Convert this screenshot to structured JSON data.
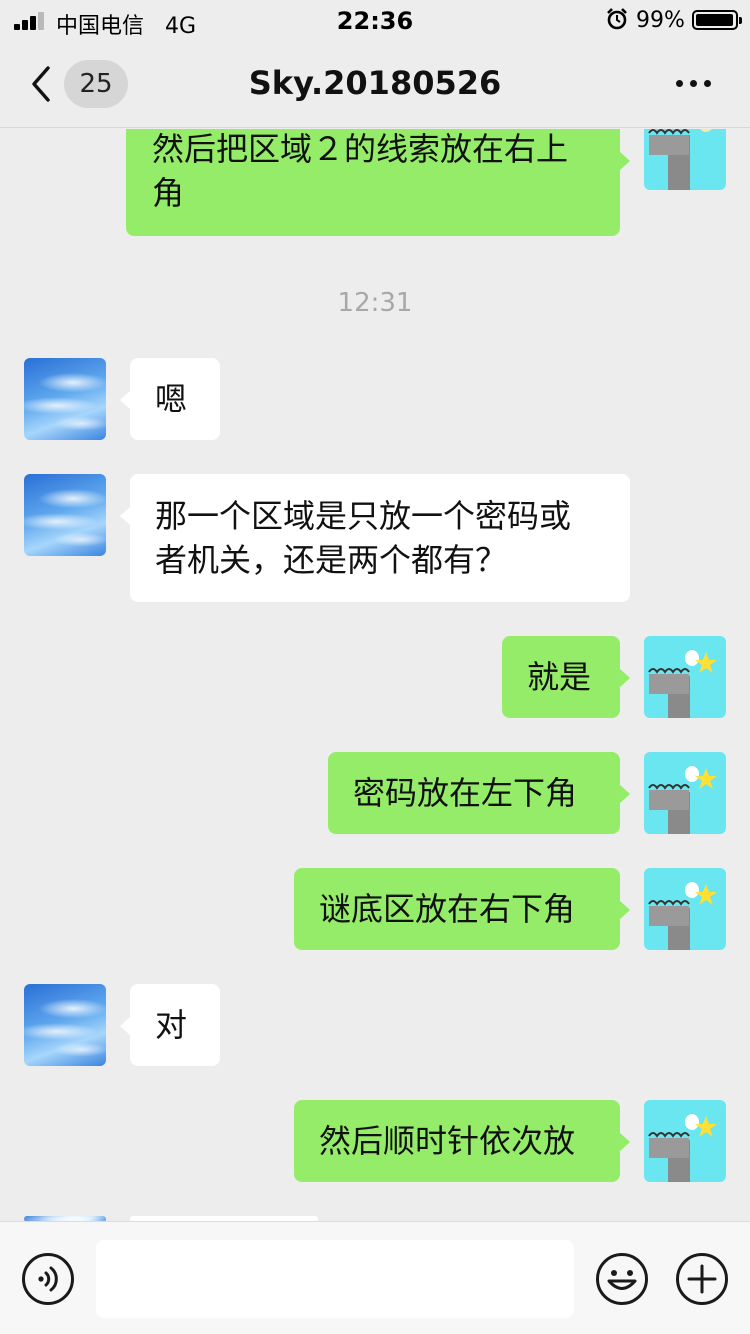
{
  "status_bar": {
    "carrier": "中国电信",
    "network": "4G",
    "time": "22:36",
    "battery": "99%"
  },
  "header": {
    "back_label": "",
    "unread_count": "25",
    "title": "Sky.20180526"
  },
  "messages": [
    {
      "sender": "me",
      "text_lines": [
        "然后把区域２的线索放在右上",
        "角"
      ]
    },
    {
      "type": "time",
      "text": "12:31"
    },
    {
      "sender": "other",
      "text_lines": [
        "嗯"
      ]
    },
    {
      "sender": "other",
      "text_lines": [
        "那一个区域是只放一个密码或",
        "者机关，还是两个都有？"
      ]
    },
    {
      "sender": "me",
      "text_lines": [
        "就是"
      ]
    },
    {
      "sender": "me",
      "text_lines": [
        "密码放在左下角"
      ]
    },
    {
      "sender": "me",
      "text_lines": [
        "谜底区放在右下角"
      ]
    },
    {
      "sender": "other",
      "text_lines": [
        "对"
      ]
    },
    {
      "sender": "me",
      "text_lines": [
        "然后顺时针依次放"
      ]
    }
  ],
  "input": {
    "value": "",
    "placeholder": ""
  },
  "colors": {
    "outgoing_bubble": "#95ec69",
    "incoming_bubble": "#ffffff",
    "background": "#ededed"
  },
  "icons": {
    "back": "chevron-left-icon",
    "more": "more-dots-icon",
    "voice": "voice-icon",
    "emoji": "emoji-icon",
    "plus": "plus-icon"
  }
}
